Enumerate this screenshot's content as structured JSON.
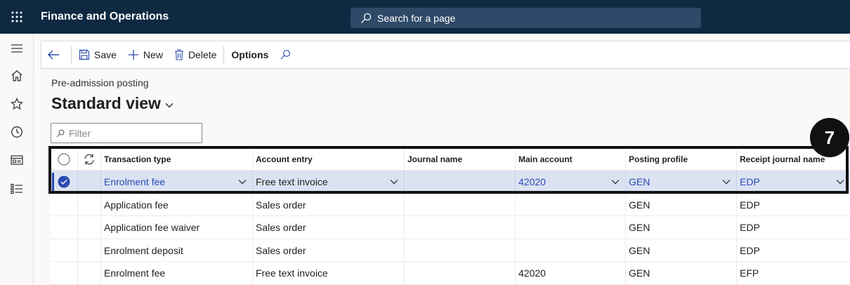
{
  "app": {
    "title": "Finance and Operations"
  },
  "search": {
    "placeholder": "Search for a page"
  },
  "leftnav": {
    "items": [
      "menu-icon",
      "home-icon",
      "star-icon",
      "clock-icon",
      "workspace-icon",
      "list-icon"
    ]
  },
  "toolbar": {
    "save_label": "Save",
    "new_label": "New",
    "delete_label": "Delete",
    "options_label": "Options"
  },
  "page": {
    "caption": "Pre-admission posting",
    "view_title": "Standard view"
  },
  "filter": {
    "placeholder": "Filter"
  },
  "grid": {
    "columns": [
      "Transaction type",
      "Account entry",
      "Journal name",
      "Main account",
      "Posting profile",
      "Receipt journal name"
    ],
    "rows": [
      {
        "transaction_type": "Enrolment fee",
        "account_entry": "Free text invoice",
        "journal_name": "",
        "main_account": "42020",
        "posting_profile": "GEN",
        "receipt_journal": "EDP",
        "selected": true
      },
      {
        "transaction_type": "Application fee",
        "account_entry": "Sales order",
        "journal_name": "",
        "main_account": "",
        "posting_profile": "GEN",
        "receipt_journal": "EDP",
        "selected": false
      },
      {
        "transaction_type": "Application fee waiver",
        "account_entry": "Sales order",
        "journal_name": "",
        "main_account": "",
        "posting_profile": "GEN",
        "receipt_journal": "EDP",
        "selected": false
      },
      {
        "transaction_type": "Enrolment deposit",
        "account_entry": "Sales order",
        "journal_name": "",
        "main_account": "",
        "posting_profile": "GEN",
        "receipt_journal": "EDP",
        "selected": false
      },
      {
        "transaction_type": "Enrolment fee",
        "account_entry": "Free text invoice",
        "journal_name": "",
        "main_account": "42020",
        "posting_profile": "GEN",
        "receipt_journal": "EFP",
        "selected": false
      }
    ]
  },
  "callout": {
    "number": "7"
  },
  "colors": {
    "topbar": "#0f2942",
    "accent": "#2b4bb0",
    "selected_row": "#dbe3f3"
  }
}
